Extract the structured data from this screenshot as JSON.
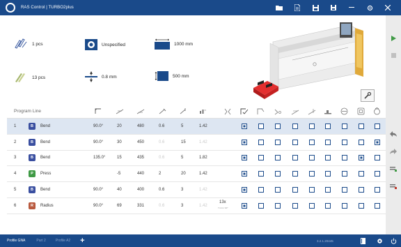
{
  "window": {
    "title": "RAS Control | TURBO2plus",
    "logo_text": "RAS"
  },
  "info": {
    "quantity": "1 pcs",
    "tool_status": "Unspecified",
    "length": "1000 mm",
    "stack": "13 pcs",
    "thickness": "0.8 mm",
    "width": "500 mm"
  },
  "table": {
    "header_label": "Program Line",
    "rows": [
      {
        "num": "1",
        "badge": "B",
        "type": "bend",
        "name": "Bend",
        "angle": "90.0°",
        "c1": "20",
        "c2": "480",
        "c3": "0.6",
        "c4": "5",
        "c5": "1.42",
        "c3_faded": false,
        "c5_faded": false,
        "extra": "",
        "extra_sub": "",
        "checks": [
          1,
          0,
          0,
          0,
          0,
          0,
          0,
          0,
          0
        ]
      },
      {
        "num": "2",
        "badge": "B",
        "type": "bend",
        "name": "Bend",
        "angle": "90.0°",
        "c1": "30",
        "c2": "450",
        "c3": "0.6",
        "c4": "15",
        "c5": "1.42",
        "c3_faded": true,
        "c5_faded": true,
        "extra": "",
        "extra_sub": "",
        "checks": [
          1,
          0,
          0,
          0,
          0,
          0,
          0,
          0,
          1
        ]
      },
      {
        "num": "3",
        "badge": "B",
        "type": "bend",
        "name": "Bend",
        "angle": "135.0°",
        "c1": "15",
        "c2": "435",
        "c3": "0.6",
        "c4": "5",
        "c5": "1.82",
        "c3_faded": true,
        "c5_faded": false,
        "extra": "",
        "extra_sub": "",
        "checks": [
          1,
          0,
          0,
          0,
          0,
          0,
          0,
          1,
          0
        ]
      },
      {
        "num": "4",
        "badge": "P",
        "type": "press",
        "name": "Press",
        "angle": "",
        "c1": "-5",
        "c2": "440",
        "c3": "2",
        "c4": "20",
        "c5": "1.42",
        "c3_faded": false,
        "c5_faded": false,
        "extra": "",
        "extra_sub": "",
        "checks": [
          1,
          0,
          0,
          0,
          0,
          0,
          0,
          0,
          0
        ]
      },
      {
        "num": "5",
        "badge": "B",
        "type": "bend",
        "name": "Bend",
        "angle": "90.0°",
        "c1": "40",
        "c2": "400",
        "c3": "0.6",
        "c4": "3",
        "c5": "1.42",
        "c3_faded": false,
        "c5_faded": true,
        "extra": "",
        "extra_sub": "",
        "checks": [
          1,
          0,
          0,
          0,
          0,
          0,
          0,
          0,
          0
        ]
      },
      {
        "num": "6",
        "badge": "R",
        "type": "radius",
        "name": "Radius",
        "angle": "90.0°",
        "c1": "69",
        "c2": "331",
        "c3": "0.6",
        "c4": "3",
        "c5": "1.42",
        "c3_faded": true,
        "c5_faded": true,
        "extra": "13x",
        "extra_sub": "7 mm / 10°",
        "checks": [
          1,
          0,
          0,
          0,
          0,
          0,
          0,
          0,
          0
        ]
      }
    ]
  },
  "bottom": {
    "tabs": [
      "Profile GNA",
      "Part 2",
      "Profile A2"
    ],
    "add_label": "+",
    "version": "3.2.1.20445"
  },
  "colors": {
    "brand": "#1a4a8a",
    "bend": "#3a4fa0",
    "press": "#3f9a45",
    "radius": "#b95a3f",
    "selected_row": "#dde6f2"
  }
}
